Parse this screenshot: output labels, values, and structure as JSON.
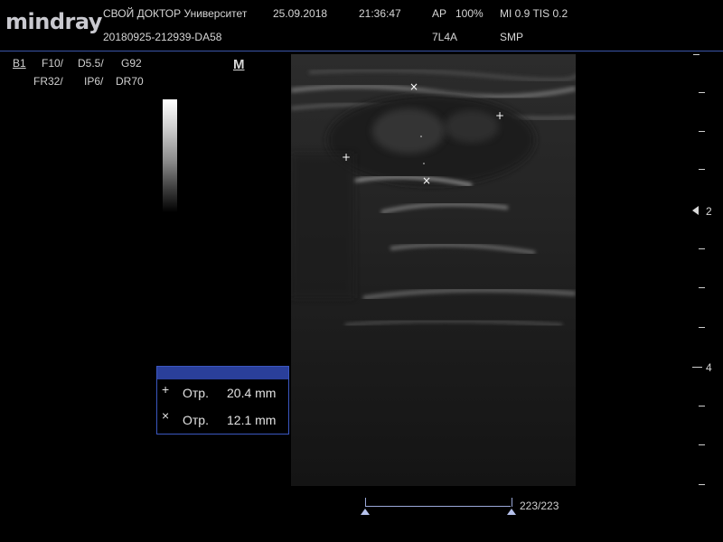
{
  "header": {
    "logo": "mindray",
    "institution": "СВОЙ ДОКТОР Университет",
    "date": "25.09.2018",
    "time": "21:36:47",
    "ap": "AP",
    "ap_value": "100%",
    "mi_tis": "MI 0.9 TIS 0.2",
    "exam_id": "20180925-212939-DA58",
    "probe": "7L4A",
    "preset": "SMP"
  },
  "params": {
    "mode": "B1",
    "freq": "F10/",
    "depth": "D5.5/",
    "gain": "G92",
    "frame_rate": "FR32/",
    "image_proc": "IP6/",
    "dynamic_range": "DR70",
    "m_marker": "M"
  },
  "depth_scale": {
    "labels": [
      "2",
      "4"
    ]
  },
  "measurements": [
    {
      "symbol": "+",
      "label": "Отр.",
      "value": "20.4 mm"
    },
    {
      "symbol": "×",
      "label": "Отр.",
      "value": "12.1 mm"
    }
  ],
  "cine": {
    "frame": "223/223"
  },
  "colors": {
    "accent": "#3a55a8",
    "box_header": "#2a3f9a"
  }
}
